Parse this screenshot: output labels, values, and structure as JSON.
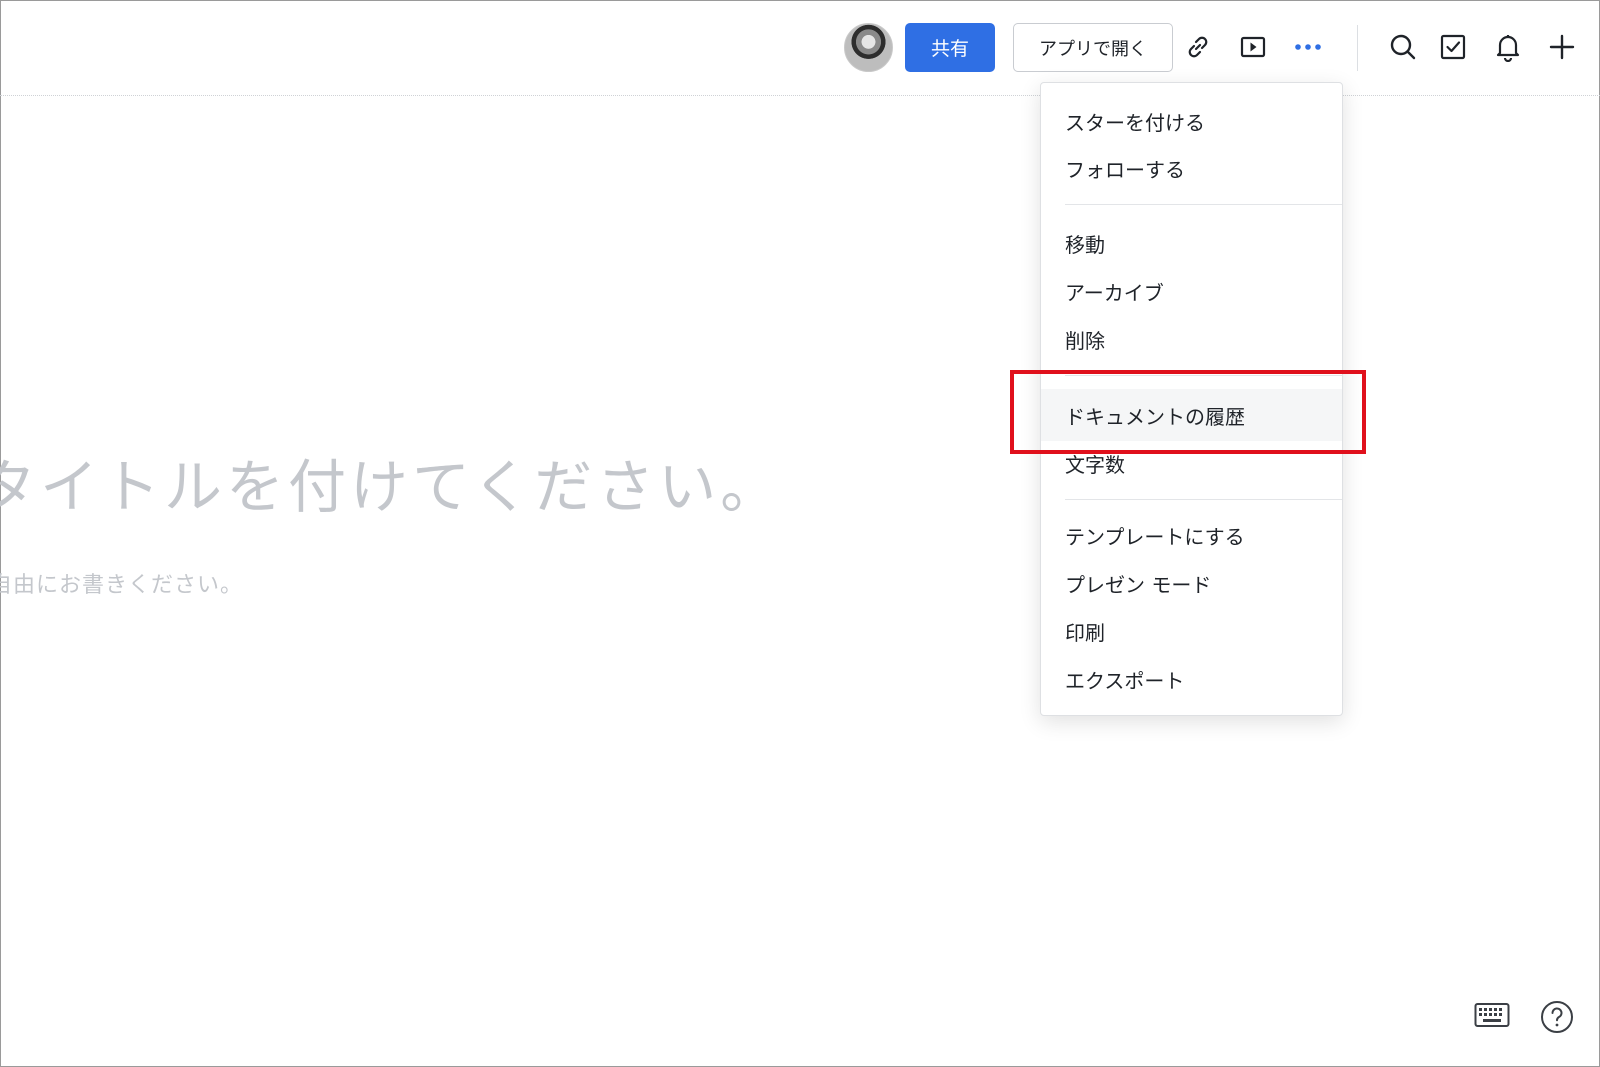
{
  "toolbar": {
    "share_label": "共有",
    "open_in_app_label": "アプリで開く",
    "icons": [
      "avatar",
      "link-icon",
      "present-icon",
      "more-icon",
      "search-icon",
      "task-icon",
      "bell-icon",
      "plus-icon"
    ],
    "accent_color": "#2f6fe4"
  },
  "document": {
    "title_placeholder": "タイトルを付けてください。",
    "body_placeholder": "自由にお書きください。"
  },
  "more_menu": {
    "groups": [
      [
        "スターを付ける",
        "フォローする"
      ],
      [
        "移動",
        "アーカイブ",
        "削除"
      ],
      [
        "ドキュメントの履歴",
        "文字数"
      ],
      [
        "テンプレートにする",
        "プレゼン モード",
        "印刷",
        "エクスポート"
      ]
    ],
    "highlighted_item": "ドキュメントの履歴",
    "highlight_color": "#e0101c"
  },
  "footer": {
    "icons": [
      "keyboard-icon",
      "help-icon"
    ]
  }
}
